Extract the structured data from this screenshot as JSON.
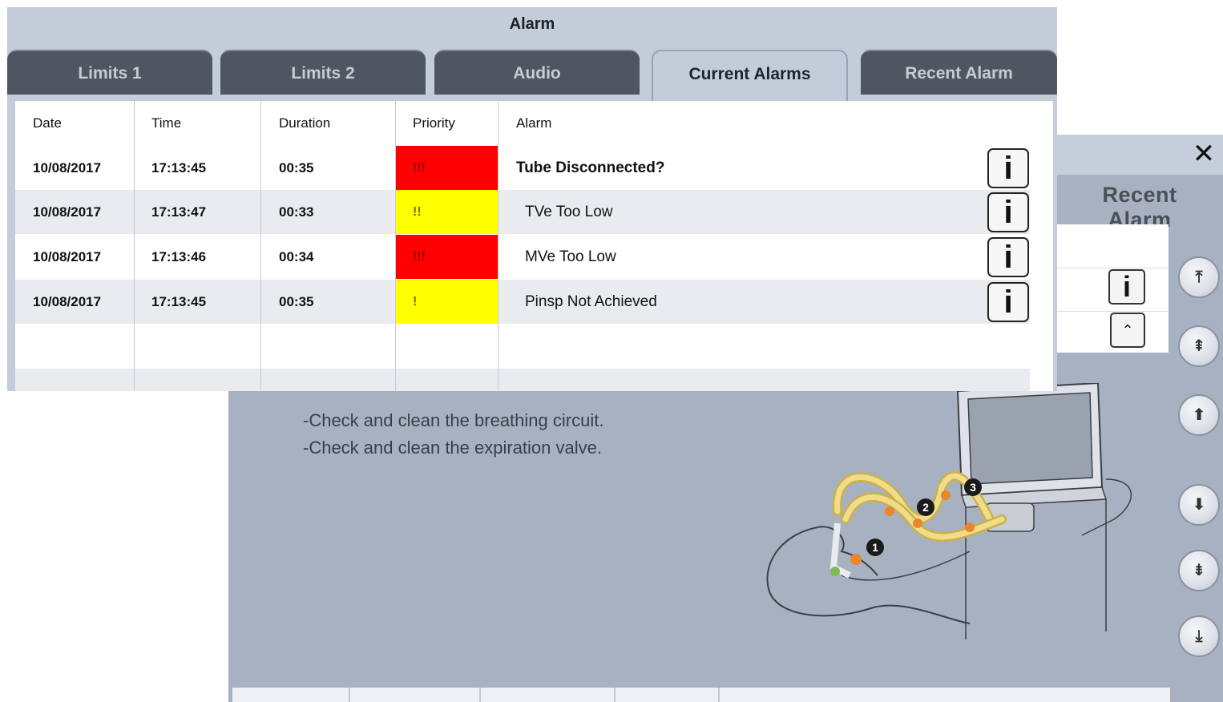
{
  "help_window": {
    "close_glyph": "✕",
    "tab_label": "Recent Alarm",
    "info_glyph": "i",
    "collapse_glyph": "⌃",
    "instructions": [
      "-Check and clean the breathing circuit.",
      "-Check and clean the expiration valve."
    ],
    "nav_buttons": [
      {
        "name": "scroll-top",
        "glyph": "⤒"
      },
      {
        "name": "page-up",
        "glyph": "⇞"
      },
      {
        "name": "line-up",
        "glyph": "⬆"
      },
      {
        "name": "line-down",
        "glyph": "⬇"
      },
      {
        "name": "page-down",
        "glyph": "⇟"
      },
      {
        "name": "scroll-bottom",
        "glyph": "⤓"
      }
    ],
    "callouts": [
      "1",
      "2",
      "3"
    ]
  },
  "alarm_window": {
    "title": "Alarm",
    "tabs": [
      {
        "label": "Limits 1",
        "active": false
      },
      {
        "label": "Limits 2",
        "active": false
      },
      {
        "label": "Audio",
        "active": false
      },
      {
        "label": "Current Alarms",
        "active": true
      },
      {
        "label": "Recent Alarm",
        "active": false
      }
    ],
    "columns": [
      "Date",
      "Time",
      "Duration",
      "Priority",
      "Alarm"
    ],
    "rows": [
      {
        "date": "10/08/2017",
        "time": "17:13:45",
        "duration": "00:35",
        "priority": "!!!",
        "priority_color": "#ff0000",
        "alarm": "Tube Disconnected?",
        "bold": true
      },
      {
        "date": "10/08/2017",
        "time": "17:13:47",
        "duration": "00:33",
        "priority": "!!",
        "priority_color": "#ffff00",
        "alarm": "TVe Too Low",
        "bold": false
      },
      {
        "date": "10/08/2017",
        "time": "17:13:46",
        "duration": "00:34",
        "priority": "!!!",
        "priority_color": "#ff0000",
        "alarm": "MVe Too Low",
        "bold": false
      },
      {
        "date": "10/08/2017",
        "time": "17:13:45",
        "duration": "00:35",
        "priority": "!",
        "priority_color": "#ffff00",
        "alarm": "Pinsp Not Achieved",
        "bold": false
      }
    ],
    "info_glyph": "i"
  }
}
